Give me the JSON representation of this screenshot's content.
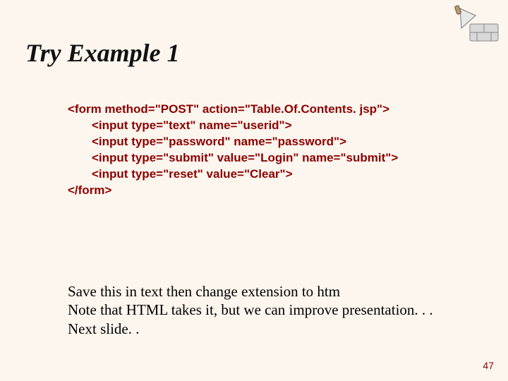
{
  "title": "Try Example 1",
  "code": {
    "l1": "<form method=\"POST\" action=\"Table.Of.Contents. jsp\">",
    "l2": "<input type=\"text\" name=\"userid\">",
    "l3": "<input type=\"password\" name=\"password\">",
    "l4": "<input type=\"submit\" value=\"Login\" name=\"submit\">",
    "l5": "<input type=\"reset\" value=\"Clear\">",
    "l6": "</form>"
  },
  "notes": {
    "n1": "Save this in text  then change extension to htm",
    "n2": "Note that HTML takes it, but we can improve presentation. . .",
    "n3": "Next slide. ."
  },
  "page_number": "47"
}
